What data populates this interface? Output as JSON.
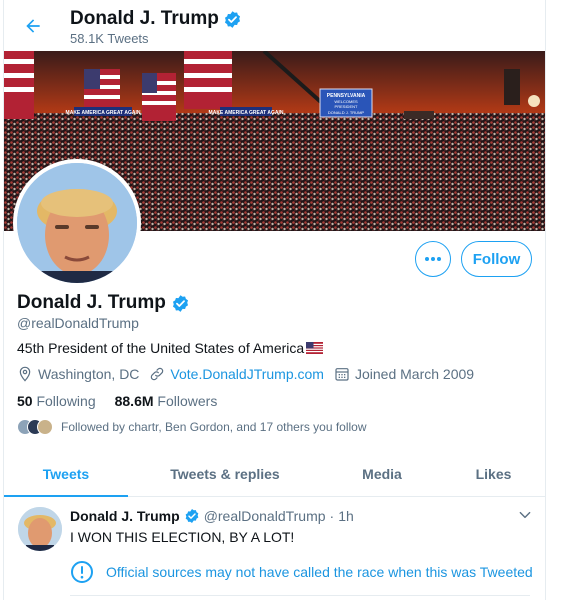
{
  "header": {
    "title": "Donald J. Trump",
    "tweet_count": "58.1K Tweets"
  },
  "banner": {
    "sign_line1": "PENNSYLVANIA",
    "sign_line2": "WELCOMES",
    "sign_line3": "PRESIDENT",
    "sign_line4": "DONALD J. TRUMP",
    "banner_text_left": "MAKE AMERICA GREAT AGAIN",
    "banner_text_right": "MAKE AMERICA GREAT AGAIN"
  },
  "profile": {
    "name": "Donald J. Trump",
    "handle": "@realDonaldTrump",
    "bio": "45th President of the United States of America",
    "bio_flag_icon": "us-flag-icon",
    "location": "Washington, DC",
    "website": "Vote.DonaldJTrump.com",
    "joined": "Joined March 2009",
    "following_count": "50",
    "following_label": "Following",
    "followers_count": "88.6M",
    "followers_label": "Followers",
    "followed_by": "Followed by chartr, Ben Gordon, and 17 others you follow",
    "follow_label": "Follow",
    "verified_color": "#1da1f2"
  },
  "tabs": [
    {
      "label": "Tweets",
      "active": true
    },
    {
      "label": "Tweets & replies",
      "active": false
    },
    {
      "label": "Media",
      "active": false
    },
    {
      "label": "Likes",
      "active": false
    }
  ],
  "tweet": {
    "name": "Donald J. Trump",
    "handle": "@realDonaldTrump",
    "separator": "·",
    "time": "1h",
    "text": "I WON THIS ELECTION, BY A LOT!",
    "notice": "Official sources may not have called the race when this was Tweeted"
  },
  "colors": {
    "accent": "#1da1f2",
    "link": "#1b95e0",
    "secondary_text": "#5b7083"
  }
}
